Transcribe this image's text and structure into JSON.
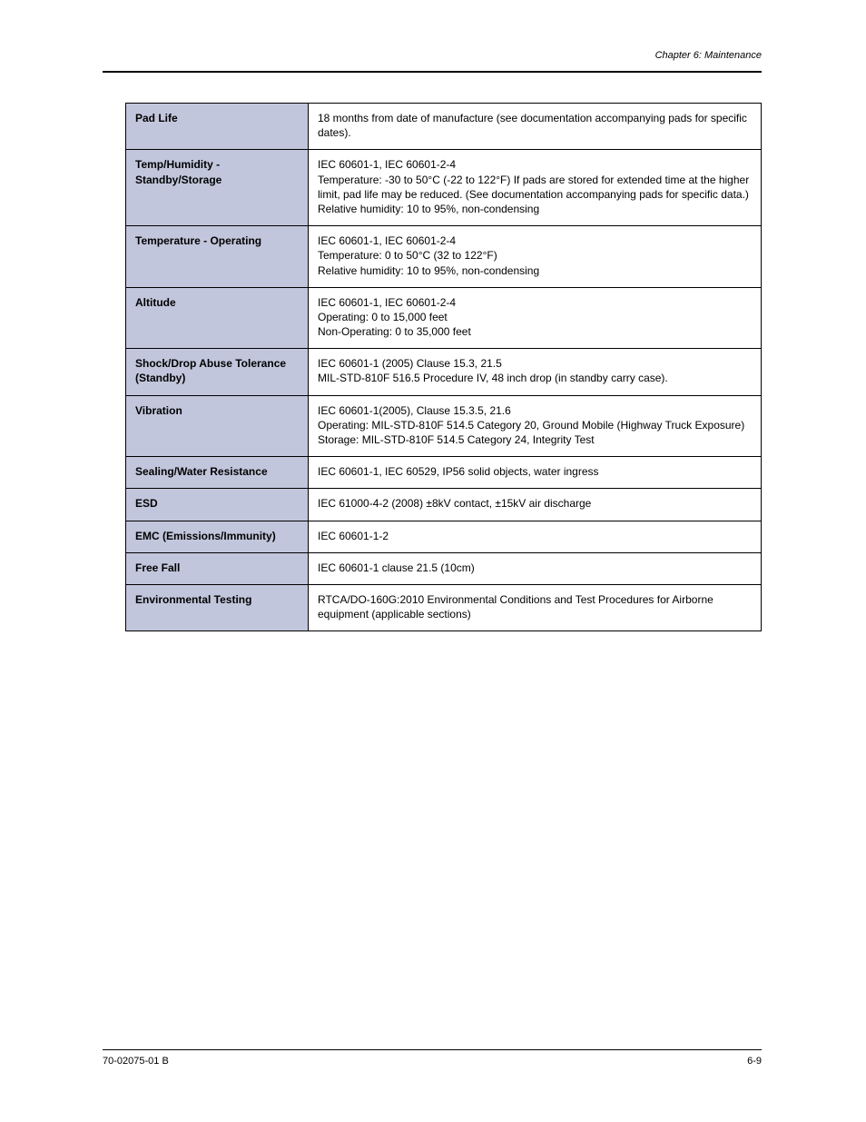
{
  "header_right": "Chapter 6: Maintenance",
  "rows": [
    {
      "label": "Pad Life",
      "value": "18 months from date of manufacture (see documentation accompanying pads for specific dates)."
    },
    {
      "label": "Temp/Humidity - Standby/Storage",
      "value": "IEC 60601-1, IEC 60601-2-4\nTemperature: -30 to 50°C (-22 to 122°F) If pads are stored for extended time at the higher limit, pad life may be reduced. (See documentation accompanying pads for specific data.)\nRelative humidity: 10 to 95%, non-condensing"
    },
    {
      "label": "Temperature - Operating",
      "value": "IEC 60601-1, IEC 60601-2-4\nTemperature: 0 to 50°C (32 to 122°F)\nRelative humidity: 10 to 95%, non-condensing"
    },
    {
      "label": "Altitude",
      "value": "IEC 60601-1, IEC 60601-2-4\nOperating: 0 to 15,000 feet\nNon-Operating: 0 to 35,000 feet\n"
    },
    {
      "label": "Shock/Drop Abuse Tolerance (Standby)",
      "value": "IEC 60601-1 (2005) Clause 15.3, 21.5\nMIL-STD-810F 516.5 Procedure IV, 48 inch drop (in standby carry case).\n"
    },
    {
      "label": "Vibration",
      "value": "IEC 60601-1(2005), Clause 15.3.5, 21.6\nOperating: MIL-STD-810F 514.5 Category 20, Ground Mobile (Highway Truck Exposure)\nStorage: MIL-STD-810F 514.5 Category 24, Integrity Test\n"
    },
    {
      "label": "Sealing/Water Resistance",
      "value": "IEC 60601-1, IEC 60529, IP56 solid objects, water ingress"
    },
    {
      "label": "ESD",
      "value": "IEC 61000-4-2 (2008) ±8kV contact, ±15kV air discharge"
    },
    {
      "label": "EMC (Emissions/Immunity)",
      "value": "IEC 60601-1-2"
    },
    {
      "label": "Free Fall",
      "value": "IEC 60601-1 clause 21.5 (10cm)"
    },
    {
      "label": "Environmental Testing",
      "value": "RTCA/DO-160G:2010 Environmental Conditions and Test Procedures for Airborne equipment (applicable sections)"
    }
  ],
  "footer_left": "70-02075-01 B",
  "footer_right": "6-9"
}
